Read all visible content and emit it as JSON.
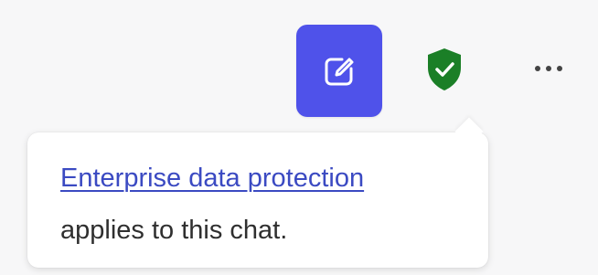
{
  "toolbar": {
    "new_chat_button": {
      "icon": "compose-icon",
      "color": "#4f52ea"
    },
    "protection_badge": {
      "icon": "shield-check-icon",
      "color": "#1b7f27"
    },
    "more_button": {
      "icon": "more-horizontal-icon"
    }
  },
  "tooltip": {
    "link_text": "Enterprise data protection",
    "body_text": "applies to this chat."
  }
}
